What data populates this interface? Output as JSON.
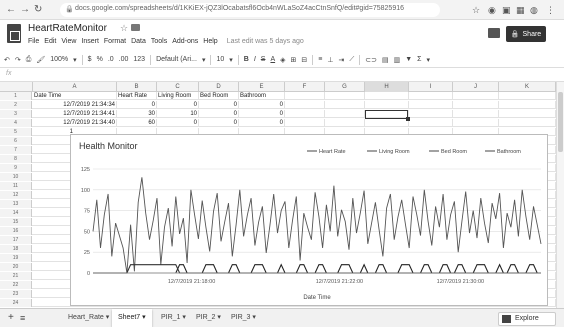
{
  "browser": {
    "url": "docs.google.com/spreadsheets/d/1KKiEX-jQZ3lOcabatsfl6Ocb4nWLaSoZ4acCtnSnfQ/edit#gid=75825916",
    "back_icon": "arrow-left-icon",
    "forward_icon": "arrow-right-icon",
    "reload_icon": "reload-icon"
  },
  "app": {
    "title": "HeartRateMonitor",
    "menu": [
      "File",
      "Edit",
      "View",
      "Insert",
      "Format",
      "Data",
      "Tools",
      "Add-ons",
      "Help"
    ],
    "last_edit": "Last edit was 5 days ago",
    "share_label": "Share"
  },
  "toolbar": {
    "zoom": "100%",
    "currency": "$",
    "percent": "%",
    "decimal_less": ".0",
    "decimal_more": ".00",
    "number_format": "123",
    "font": "Default (Ari...",
    "font_size": "10",
    "bold": "B",
    "italic": "I",
    "strike": "S",
    "text_color": "A",
    "sigma": "Σ"
  },
  "formula_bar": {
    "fx": "fx"
  },
  "grid": {
    "columns": [
      "A",
      "B",
      "C",
      "D",
      "E",
      "F",
      "G",
      "H",
      "I",
      "J",
      "K"
    ],
    "row_numbers": [
      "1",
      "2",
      "3",
      "4",
      "5",
      "6",
      "7",
      "8",
      "9",
      "10",
      "11",
      "12",
      "13",
      "14",
      "15",
      "16",
      "17",
      "18",
      "19",
      "20",
      "21",
      "22",
      "23",
      "24",
      "25"
    ],
    "header_row": [
      "Date Time",
      "Heart Rate",
      "Living Room",
      "Bed Room",
      "Bathroom"
    ],
    "data_rows": [
      [
        "12/7/2019 21:34:34",
        "0",
        "0",
        "0",
        "0"
      ],
      [
        "12/7/2019 21:34:41",
        "30",
        "10",
        "0",
        "0"
      ],
      [
        "12/7/2019 21:34:40",
        "60",
        "0",
        "0",
        "0"
      ]
    ],
    "col_a_stub": "1"
  },
  "chart": {
    "title": "Health Monitor",
    "legend": [
      "Heart Rate",
      "Living Room",
      "Bed Room",
      "Bathroom"
    ],
    "xlabel": "Date Time",
    "x_ticks": [
      "12/7/2019 21:18:00",
      "12/7/2019 21:22:00",
      "12/7/2019 21:30:00"
    ],
    "y_ticks": [
      "0",
      "25",
      "50",
      "75",
      "100",
      "125"
    ]
  },
  "chart_data": {
    "type": "line",
    "title": "Health Monitor",
    "xlabel": "Date Time",
    "ylabel": "",
    "ylim": [
      0,
      125
    ],
    "legend_position": "top",
    "series": [
      {
        "name": "Heart Rate",
        "values": [
          50,
          88,
          30,
          70,
          95,
          20,
          60,
          45,
          30,
          0,
          58,
          2,
          85,
          115,
          72,
          40,
          63,
          90,
          10,
          55,
          78,
          32,
          92,
          47,
          66,
          12,
          100,
          70,
          41,
          87,
          55,
          26,
          74,
          96,
          38,
          62,
          84,
          20,
          58,
          100,
          44,
          70,
          90,
          33,
          61,
          80,
          24,
          57,
          95,
          48,
          75,
          86,
          30,
          63,
          92,
          15,
          72,
          55,
          40,
          97,
          68,
          30,
          82,
          50,
          105,
          44,
          76,
          62,
          28,
          90,
          48,
          72,
          99,
          35,
          60,
          85,
          52,
          20,
          78,
          95,
          40,
          67,
          88,
          58,
          30,
          92,
          70,
          45,
          100,
          62,
          33,
          80,
          55,
          95,
          40,
          70,
          86,
          25,
          62,
          98,
          48,
          75,
          42,
          90,
          60,
          36,
          84,
          65,
          96,
          30,
          72,
          55,
          88,
          44,
          100,
          68,
          40,
          80,
          58,
          35
        ]
      },
      {
        "name": "Living Room",
        "values": [
          0,
          0,
          0,
          0,
          0,
          0,
          0,
          0,
          0,
          0,
          0,
          0,
          0,
          0,
          0,
          0,
          0,
          0,
          0,
          0,
          0,
          0,
          0,
          10,
          10,
          0,
          0,
          0,
          0,
          0,
          10,
          10,
          10,
          0,
          0,
          0,
          0,
          10,
          10,
          0,
          0,
          0,
          0,
          10,
          10,
          10,
          0,
          0,
          0,
          0,
          10,
          0,
          0,
          0,
          0,
          10,
          10,
          0,
          0,
          0,
          10,
          10,
          0,
          0,
          0,
          0,
          10,
          10,
          10,
          0,
          0,
          0,
          10,
          0,
          0,
          0,
          10,
          10,
          0,
          0,
          0,
          0,
          10,
          10,
          10,
          0,
          0,
          0,
          10,
          10,
          0,
          0,
          0,
          10,
          10,
          0,
          0,
          10,
          10,
          0,
          0,
          0,
          10,
          10,
          10,
          0,
          0,
          0,
          10,
          0,
          0,
          10,
          10,
          0,
          0,
          0,
          10,
          10,
          0,
          0
        ]
      },
      {
        "name": "Bed Room",
        "values": [
          0,
          0,
          0,
          0,
          0,
          0,
          0,
          0,
          0,
          0,
          0,
          0,
          0,
          0,
          0,
          0,
          0,
          0,
          0,
          0,
          0,
          0,
          0,
          0,
          0,
          0,
          0,
          0,
          0,
          0,
          0,
          0,
          0,
          0,
          0,
          0,
          0,
          0,
          0,
          0,
          0,
          0,
          0,
          0,
          0,
          0,
          0,
          0,
          0,
          0,
          0,
          0,
          0,
          0,
          0,
          0,
          0,
          0,
          0,
          0,
          0,
          0,
          0,
          0,
          0,
          0,
          0,
          0,
          0,
          0,
          0,
          0,
          0,
          0,
          0,
          0,
          0,
          0,
          0,
          0,
          0,
          0,
          0,
          0,
          0,
          0,
          0,
          0,
          0,
          0,
          0,
          0,
          0,
          0,
          0,
          0,
          0,
          0,
          0,
          0,
          0,
          0,
          0,
          0,
          0,
          0,
          0,
          0,
          0,
          0,
          0,
          0,
          0,
          0,
          0,
          0,
          0,
          0,
          0,
          0
        ]
      },
      {
        "name": "Bathroom",
        "values": [
          0,
          0,
          0,
          0,
          0,
          0,
          0,
          0,
          0,
          0,
          10,
          10,
          10,
          10,
          10,
          10,
          10,
          10,
          10,
          10,
          10,
          10,
          10,
          0,
          0,
          0,
          0,
          0,
          0,
          0,
          0,
          0,
          0,
          0,
          0,
          0,
          0,
          0,
          0,
          0,
          0,
          0,
          0,
          0,
          0,
          0,
          0,
          0,
          0,
          0,
          0,
          0,
          0,
          0,
          0,
          0,
          0,
          0,
          0,
          0,
          0,
          0,
          0,
          0,
          0,
          0,
          0,
          0,
          0,
          0,
          0,
          0,
          0,
          0,
          0,
          0,
          0,
          0,
          0,
          0,
          0,
          0,
          0,
          0,
          0,
          0,
          0,
          0,
          0,
          0,
          0,
          0,
          0,
          0,
          0,
          0,
          0,
          0,
          0,
          0,
          0,
          0,
          0,
          0,
          0,
          0,
          0,
          0,
          0,
          0,
          0,
          0,
          0,
          0,
          0,
          0,
          0,
          0,
          0,
          0
        ]
      }
    ]
  },
  "sheets": {
    "tabs": [
      "Heart_Rate",
      "Sheet7",
      "PIR_1",
      "PIR_2",
      "PIR_3"
    ],
    "active": "Sheet7",
    "explore_label": "Explore"
  }
}
